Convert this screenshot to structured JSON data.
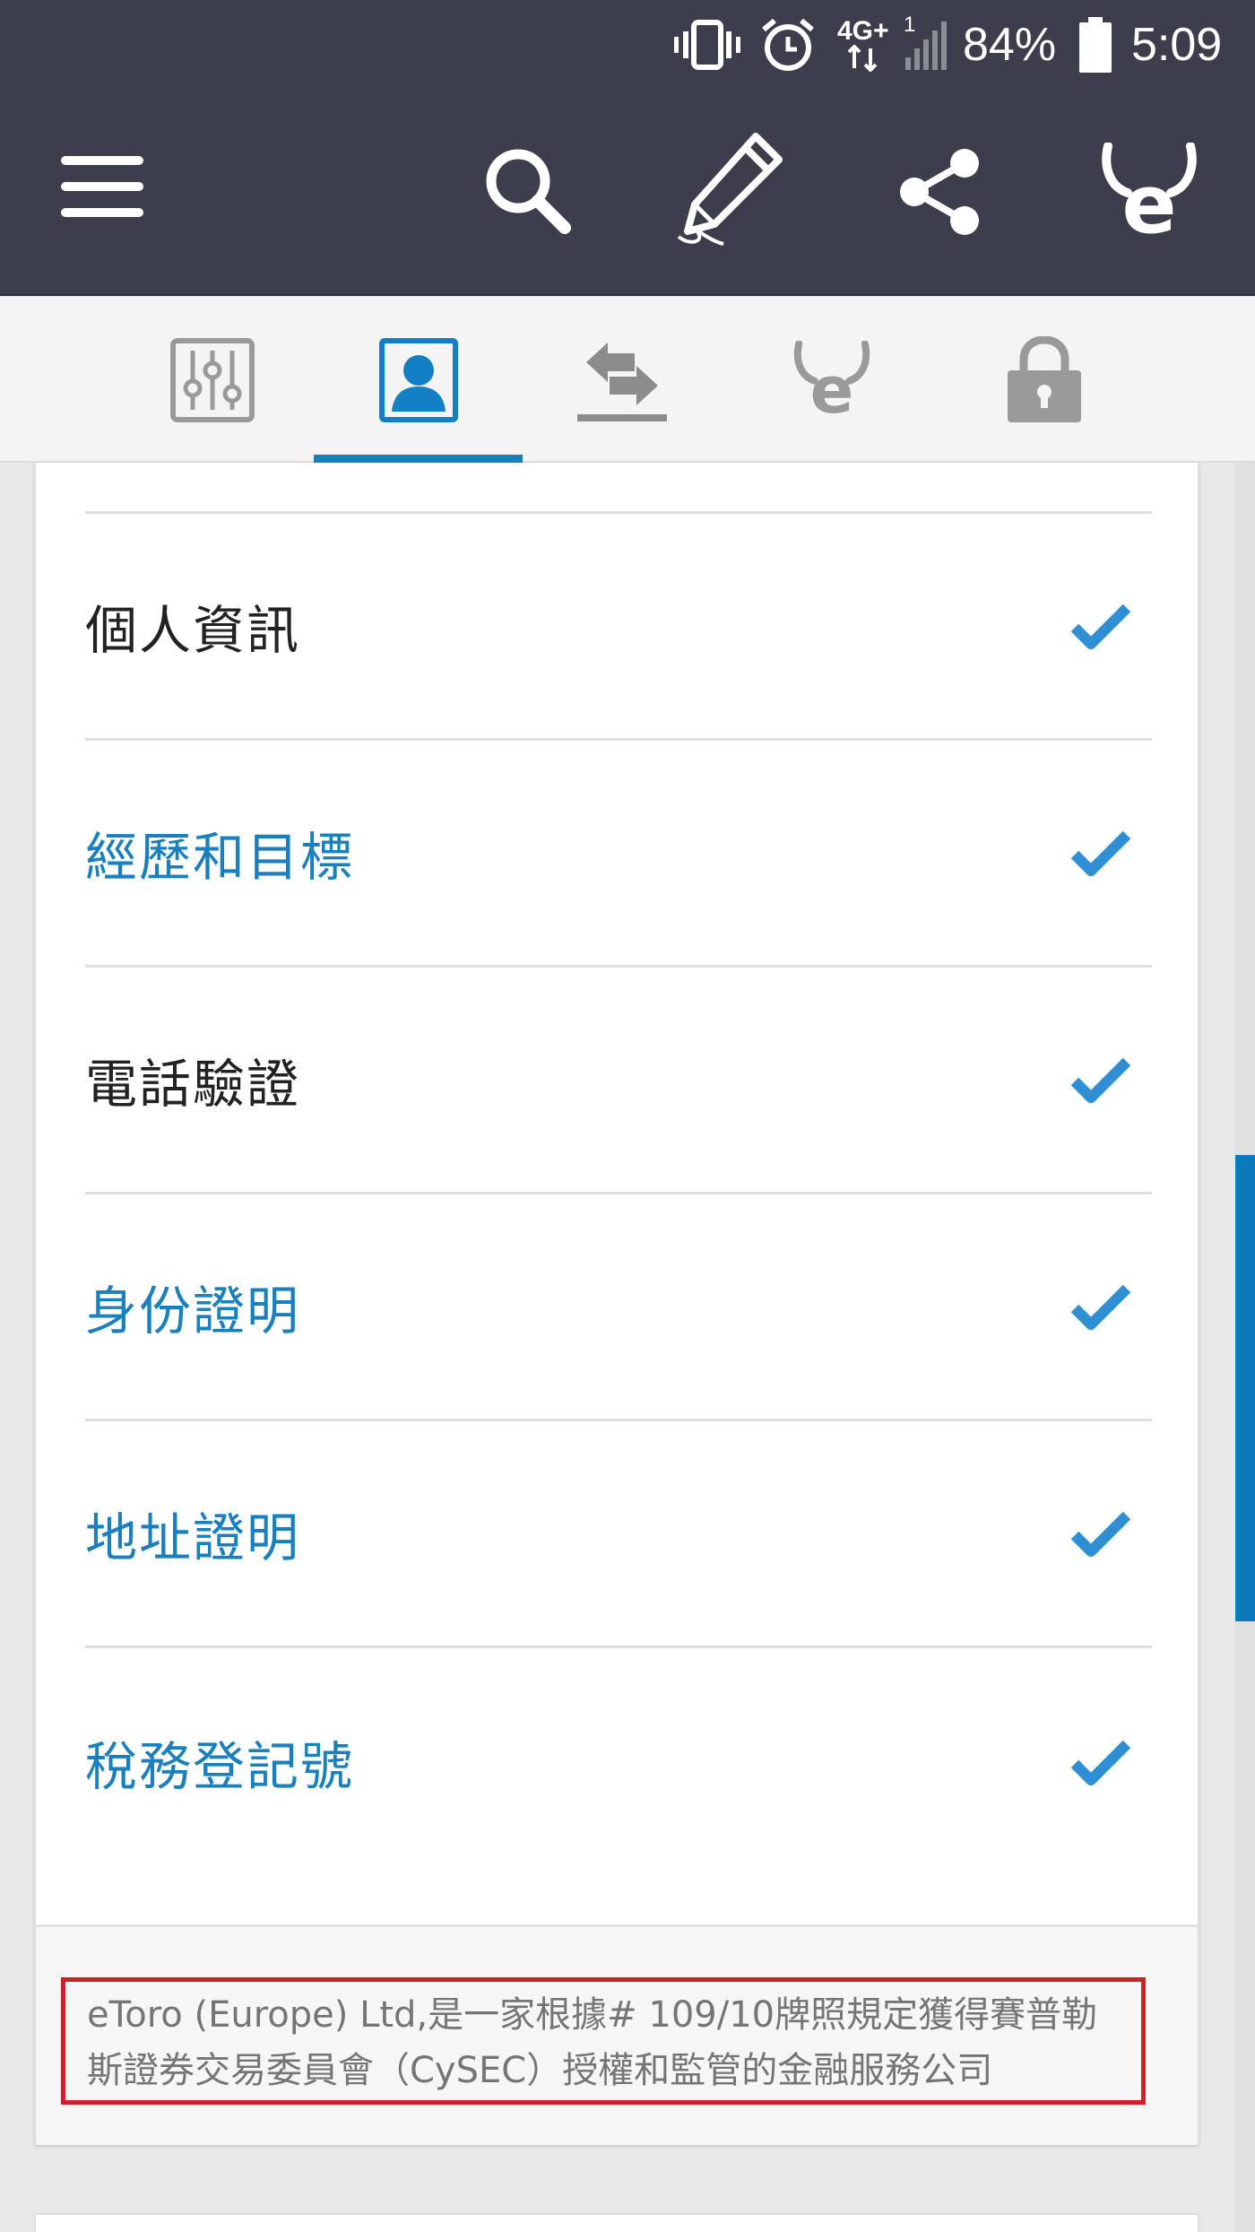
{
  "status_bar": {
    "network": "4G+",
    "sim": "1",
    "battery": "84%",
    "time": "5:09",
    "icons": [
      "vibrate-icon",
      "alarm-icon",
      "network-icon",
      "signal-icon",
      "battery-icon"
    ]
  },
  "header": {
    "icons": [
      "menu-icon",
      "search-icon",
      "edit-icon",
      "share-icon",
      "etoro-logo-icon"
    ]
  },
  "tabs": [
    {
      "name": "settings",
      "icon": "sliders-icon",
      "active": false
    },
    {
      "name": "profile",
      "icon": "user-icon",
      "active": true
    },
    {
      "name": "transfer",
      "icon": "transfer-icon",
      "active": false
    },
    {
      "name": "etoro",
      "icon": "etoro-icon",
      "active": false
    },
    {
      "name": "security",
      "icon": "lock-icon",
      "active": false
    }
  ],
  "verification_items": [
    {
      "label": "個人資訊",
      "link": false,
      "status": "check-icon"
    },
    {
      "label": "經歷和目標",
      "link": true,
      "status": "check-icon"
    },
    {
      "label": "電話驗證",
      "link": false,
      "status": "check-icon"
    },
    {
      "label": "身份證明",
      "link": true,
      "status": "check-icon"
    },
    {
      "label": "地址證明",
      "link": true,
      "status": "check-icon"
    },
    {
      "label": "稅務登記號",
      "link": true,
      "status": "check-icon"
    }
  ],
  "footer": {
    "disclaimer_line1": "eToro (Europe) Ltd,是一家根據# 109/10牌照規定獲得賽普勒",
    "disclaimer_line2": "斯證券交易委員會（CySEC）授權和監管的金融服務公司"
  },
  "colors": {
    "header_bg": "#3c3e4b",
    "accent": "#1480c4",
    "link_text": "#1a7fbe",
    "check": "#2e8fd4",
    "disclaimer_border": "#d0202a"
  }
}
